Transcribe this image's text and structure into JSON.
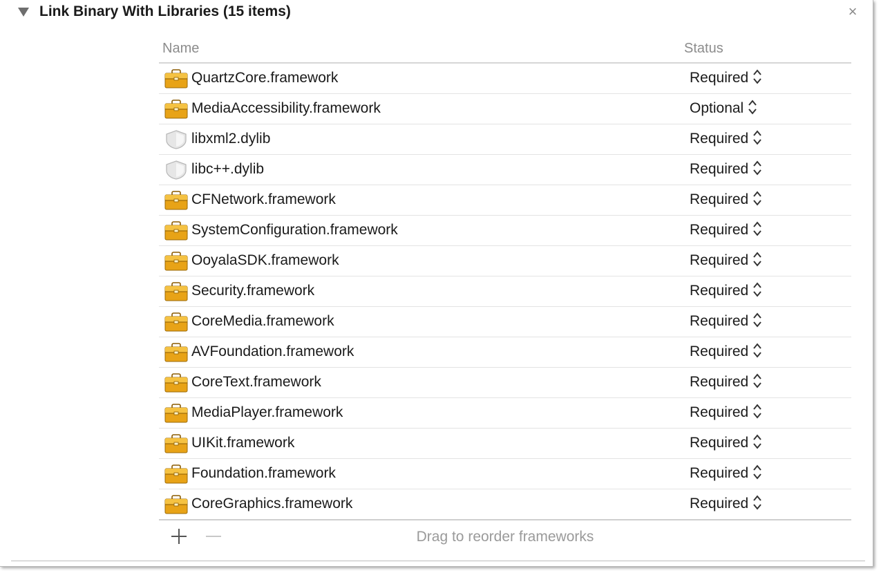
{
  "section": {
    "title": "Link Binary With Libraries (15 items)",
    "close_symbol": "×"
  },
  "table": {
    "headers": {
      "name": "Name",
      "status": "Status"
    },
    "rows": [
      {
        "name": "QuartzCore.framework",
        "status": "Required",
        "icon": "framework-icon"
      },
      {
        "name": "MediaAccessibility.framework",
        "status": "Optional",
        "icon": "framework-icon"
      },
      {
        "name": "libxml2.dylib",
        "status": "Required",
        "icon": "library-icon"
      },
      {
        "name": "libc++.dylib",
        "status": "Required",
        "icon": "library-icon"
      },
      {
        "name": "CFNetwork.framework",
        "status": "Required",
        "icon": "framework-icon"
      },
      {
        "name": "SystemConfiguration.framework",
        "status": "Required",
        "icon": "framework-icon"
      },
      {
        "name": "OoyalaSDK.framework",
        "status": "Required",
        "icon": "framework-icon"
      },
      {
        "name": "Security.framework",
        "status": "Required",
        "icon": "framework-icon"
      },
      {
        "name": "CoreMedia.framework",
        "status": "Required",
        "icon": "framework-icon"
      },
      {
        "name": "AVFoundation.framework",
        "status": "Required",
        "icon": "framework-icon"
      },
      {
        "name": "CoreText.framework",
        "status": "Required",
        "icon": "framework-icon"
      },
      {
        "name": "MediaPlayer.framework",
        "status": "Required",
        "icon": "framework-icon"
      },
      {
        "name": "UIKit.framework",
        "status": "Required",
        "icon": "framework-icon"
      },
      {
        "name": "Foundation.framework",
        "status": "Required",
        "icon": "framework-icon"
      },
      {
        "name": "CoreGraphics.framework",
        "status": "Required",
        "icon": "framework-icon"
      }
    ]
  },
  "footer": {
    "hint": "Drag to reorder frameworks"
  },
  "colors": {
    "framework_icon": "#e8a317",
    "library_icon": "#e6e6e6",
    "header_text": "#8c8c8c"
  }
}
